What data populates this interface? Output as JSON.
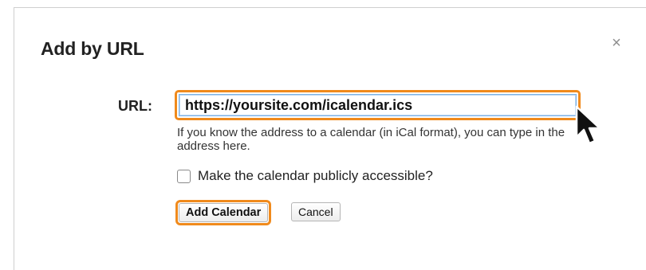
{
  "dialog": {
    "title": "Add by URL",
    "close_icon": "close-icon",
    "close_glyph": "×"
  },
  "form": {
    "url_label": "URL:",
    "url_value": "https://yoursite.com/icalendar.ics",
    "hint": "If you know the address to a calendar (in iCal format), you can type in the address here.",
    "public_checkbox_label": "Make the calendar publicly accessible?",
    "public_checked": false,
    "add_label": "Add Calendar",
    "cancel_label": "Cancel"
  },
  "colors": {
    "highlight": "#f08a1c",
    "input_focus": "#7eb2e6"
  },
  "icons": {
    "pointer": "mouse-pointer-icon"
  }
}
